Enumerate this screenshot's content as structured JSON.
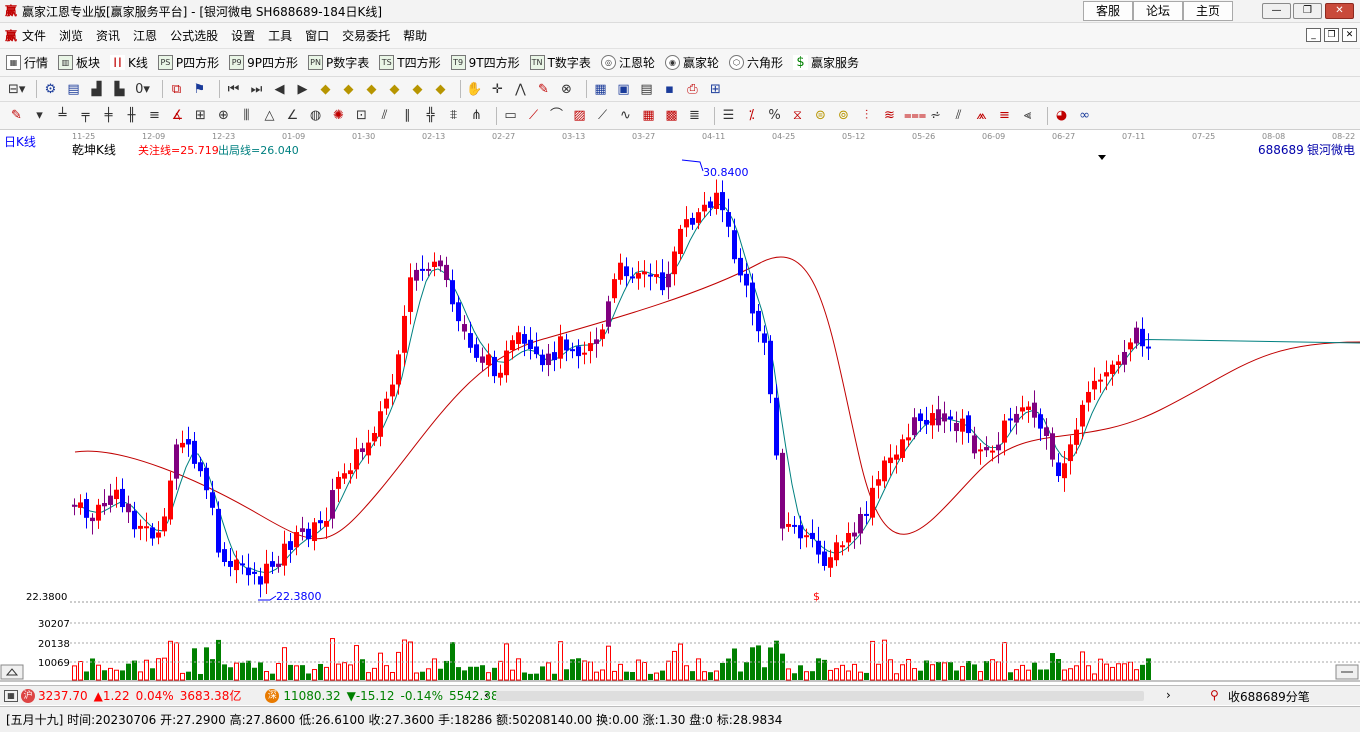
{
  "window": {
    "logo": "赢",
    "title": "赢家江恩专业版[赢家服务平台] - [银河微电   SH688689-184日K线]",
    "nav_buttons": [
      "客服",
      "论坛",
      "主页"
    ]
  },
  "menu": [
    "文件",
    "浏览",
    "资讯",
    "江恩",
    "公式选股",
    "设置",
    "工具",
    "窗口",
    "交易委托",
    "帮助"
  ],
  "toolbar1": [
    {
      "label": "行情",
      "icon": "table-icon"
    },
    {
      "label": "板块",
      "icon": "blocks-icon"
    },
    {
      "label": "K线",
      "icon": "candlestick-icon"
    },
    {
      "label": "P四方形",
      "icon": "ps-icon",
      "badge": "PS"
    },
    {
      "label": "9P四方形",
      "icon": "p9-icon",
      "badge": "P9"
    },
    {
      "label": "P数字表",
      "icon": "pn-icon",
      "badge": "PN"
    },
    {
      "label": "T四方形",
      "icon": "ts-icon",
      "badge": "TS"
    },
    {
      "label": "9T四方形",
      "icon": "t9-icon",
      "badge": "T9"
    },
    {
      "label": "T数字表",
      "icon": "tn-icon",
      "badge": "TN"
    },
    {
      "label": "江恩轮",
      "icon": "gann-wheel-icon"
    },
    {
      "label": "赢家轮",
      "icon": "winner-wheel-icon"
    },
    {
      "label": "六角形",
      "icon": "hexagon-icon"
    },
    {
      "label": "赢家服务",
      "icon": "dollar-icon"
    }
  ],
  "chart": {
    "period_label": "日K线",
    "indicator_name": "乾坤K线",
    "focus_line": "关注线=25.719",
    "exit_line": "出局线=26.040",
    "stock_code": "688689",
    "stock_name": "银河微电",
    "high_label": "30.8400",
    "low_label": "22.3800",
    "price_axis_label": "22.3800",
    "dollar_marker": "$",
    "date_ticks": [
      "11-25",
      "12-09",
      "12-23",
      "01-09",
      "01-30",
      "02-13",
      "02-27",
      "03-13",
      "03-27",
      "04-11",
      "04-25",
      "05-12",
      "05-26",
      "06-09",
      "06-27",
      "07-11",
      "07-25",
      "08-08",
      "08-22"
    ],
    "volume_ticks": [
      "30207",
      "20138",
      "10069"
    ],
    "colors": {
      "up": "#ff0000",
      "down": "#0000ff",
      "purple": "#800080",
      "volume": "#008000",
      "ma_long": "#c00000",
      "ma_short": "#008080"
    }
  },
  "status": {
    "sh_index": "3237.70",
    "sh_change": "▲1.22",
    "sh_pct": "0.04%",
    "sh_amount": "3683.38亿",
    "sz_index": "11080.32",
    "sz_change": "▼-15.12",
    "sz_pct": "-0.14%",
    "sz_amount": "5542.38",
    "right_text": "收688689分笔"
  },
  "info": {
    "text": "[五月十九] 时间:20230706 开:27.2900 高:27.8600 低:26.6100 收:27.3600 手:18286 额:50208140.00 换:0.00 涨:1.30 盘:0 标:28.9834"
  }
}
